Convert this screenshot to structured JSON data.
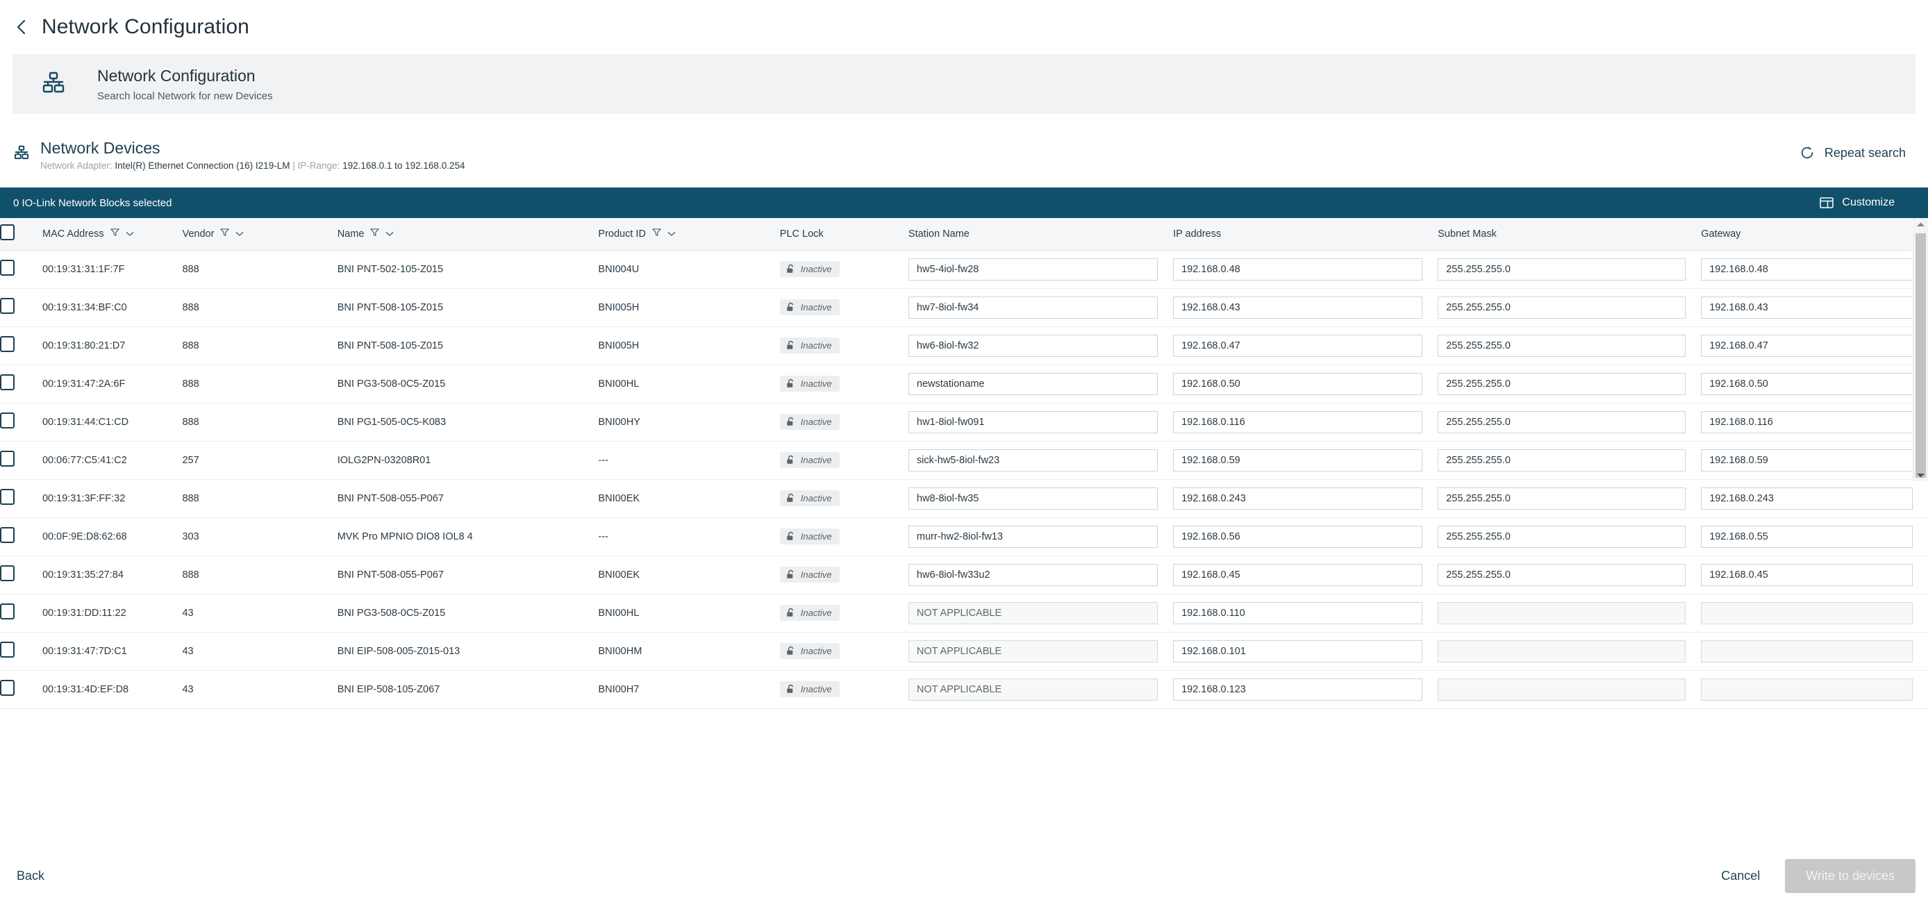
{
  "topbar": {
    "back_icon": "chevron-left-icon",
    "title": "Network Configuration"
  },
  "hero": {
    "icon": "network-topology-icon",
    "title": "Network Configuration",
    "subtitle": "Search local Network for new Devices"
  },
  "section": {
    "icon": "network-topology-icon",
    "title": "Network Devices",
    "adapter_label": "Network Adapter:",
    "adapter_value": "Intel(R) Ethernet Connection (16) I219-LM",
    "separator": "|",
    "iprange_label": "IP-Range:",
    "iprange_value": "192.168.0.1 to 192.168.0.254",
    "repeat_search_label": "Repeat search",
    "repeat_search_icon": "refresh-icon"
  },
  "selection_bar": {
    "text": "0 IO-Link Network Blocks selected",
    "customize_label": "Customize",
    "customize_icon": "layout-columns-icon",
    "background": "#11506b"
  },
  "table": {
    "columns": [
      {
        "key": "checkbox",
        "label": "",
        "filter": false,
        "sort": false
      },
      {
        "key": "mac",
        "label": "MAC Address",
        "filter": true,
        "sort": true
      },
      {
        "key": "vendor",
        "label": "Vendor",
        "filter": true,
        "sort": true
      },
      {
        "key": "name",
        "label": "Name",
        "filter": true,
        "sort": true
      },
      {
        "key": "product_id",
        "label": "Product ID",
        "filter": true,
        "sort": true
      },
      {
        "key": "plc_lock",
        "label": "PLC Lock",
        "filter": false,
        "sort": false
      },
      {
        "key": "station",
        "label": "Station Name",
        "filter": false,
        "sort": false
      },
      {
        "key": "ip",
        "label": "IP address",
        "filter": false,
        "sort": false
      },
      {
        "key": "mask",
        "label": "Subnet Mask",
        "filter": false,
        "sort": false
      },
      {
        "key": "gateway",
        "label": "Gateway",
        "filter": false,
        "sort": false
      }
    ],
    "rows": [
      {
        "mac": "00:19:31:31:1F:7F",
        "vendor": "888",
        "name": "BNI PNT-502-105-Z015",
        "product_id": "BNI004U",
        "plc_lock": "Inactive",
        "station": "hw5-4iol-fw28",
        "station_disabled": false,
        "ip": "192.168.0.48",
        "mask": "255.255.255.0",
        "gateway": "192.168.0.48"
      },
      {
        "mac": "00:19:31:34:BF:C0",
        "vendor": "888",
        "name": "BNI PNT-508-105-Z015",
        "product_id": "BNI005H",
        "plc_lock": "Inactive",
        "station": "hw7-8iol-fw34",
        "station_disabled": false,
        "ip": "192.168.0.43",
        "mask": "255.255.255.0",
        "gateway": "192.168.0.43"
      },
      {
        "mac": "00:19:31:80:21:D7",
        "vendor": "888",
        "name": "BNI PNT-508-105-Z015",
        "product_id": "BNI005H",
        "plc_lock": "Inactive",
        "station": "hw6-8iol-fw32",
        "station_disabled": false,
        "ip": "192.168.0.47",
        "mask": "255.255.255.0",
        "gateway": "192.168.0.47"
      },
      {
        "mac": "00:19:31:47:2A:6F",
        "vendor": "888",
        "name": "BNI PG3-508-0C5-Z015",
        "product_id": "BNI00HL",
        "plc_lock": "Inactive",
        "station": "newstationame",
        "station_disabled": false,
        "ip": "192.168.0.50",
        "mask": "255.255.255.0",
        "gateway": "192.168.0.50"
      },
      {
        "mac": "00:19:31:44:C1:CD",
        "vendor": "888",
        "name": "BNI PG1-505-0C5-K083",
        "product_id": "BNI00HY",
        "plc_lock": "Inactive",
        "station": "hw1-8iol-fw091",
        "station_disabled": false,
        "ip": "192.168.0.116",
        "mask": "255.255.255.0",
        "gateway": "192.168.0.116"
      },
      {
        "mac": "00:06:77:C5:41:C2",
        "vendor": "257",
        "name": "IOLG2PN-03208R01",
        "product_id": "---",
        "plc_lock": "Inactive",
        "station": "sick-hw5-8iol-fw23",
        "station_disabled": false,
        "ip": "192.168.0.59",
        "mask": "255.255.255.0",
        "gateway": "192.168.0.59"
      },
      {
        "mac": "00:19:31:3F:FF:32",
        "vendor": "888",
        "name": "BNI PNT-508-055-P067",
        "product_id": "BNI00EK",
        "plc_lock": "Inactive",
        "station": "hw8-8iol-fw35",
        "station_disabled": false,
        "ip": "192.168.0.243",
        "mask": "255.255.255.0",
        "gateway": "192.168.0.243"
      },
      {
        "mac": "00:0F:9E:D8:62:68",
        "vendor": "303",
        "name": "MVK Pro MPNIO DIO8 IOL8 4",
        "product_id": "---",
        "plc_lock": "Inactive",
        "station": "murr-hw2-8iol-fw13",
        "station_disabled": false,
        "ip": "192.168.0.56",
        "mask": "255.255.255.0",
        "gateway": "192.168.0.55"
      },
      {
        "mac": "00:19:31:35:27:84",
        "vendor": "888",
        "name": "BNI PNT-508-055-P067",
        "product_id": "BNI00EK",
        "plc_lock": "Inactive",
        "station": "hw6-8iol-fw33u2",
        "station_disabled": false,
        "ip": "192.168.0.45",
        "mask": "255.255.255.0",
        "gateway": "192.168.0.45"
      },
      {
        "mac": "00:19:31:DD:11:22",
        "vendor": "43",
        "name": "BNI PG3-508-0C5-Z015",
        "product_id": "BNI00HL",
        "plc_lock": "Inactive",
        "station": "NOT APPLICABLE",
        "station_disabled": true,
        "ip": "192.168.0.110",
        "mask": "",
        "gateway": ""
      },
      {
        "mac": "00:19:31:47:7D:C1",
        "vendor": "43",
        "name": "BNI EIP-508-005-Z015-013",
        "product_id": "BNI00HM",
        "plc_lock": "Inactive",
        "station": "NOT APPLICABLE",
        "station_disabled": true,
        "ip": "192.168.0.101",
        "mask": "",
        "gateway": ""
      },
      {
        "mac": "00:19:31:4D:EF:D8",
        "vendor": "43",
        "name": "BNI EIP-508-105-Z067",
        "product_id": "BNI00H7",
        "plc_lock": "Inactive",
        "station": "NOT APPLICABLE",
        "station_disabled": true,
        "ip": "192.168.0.123",
        "mask": "",
        "gateway": ""
      }
    ]
  },
  "footer": {
    "back_label": "Back",
    "cancel_label": "Cancel",
    "write_label": "Write to devices",
    "write_disabled": true
  }
}
